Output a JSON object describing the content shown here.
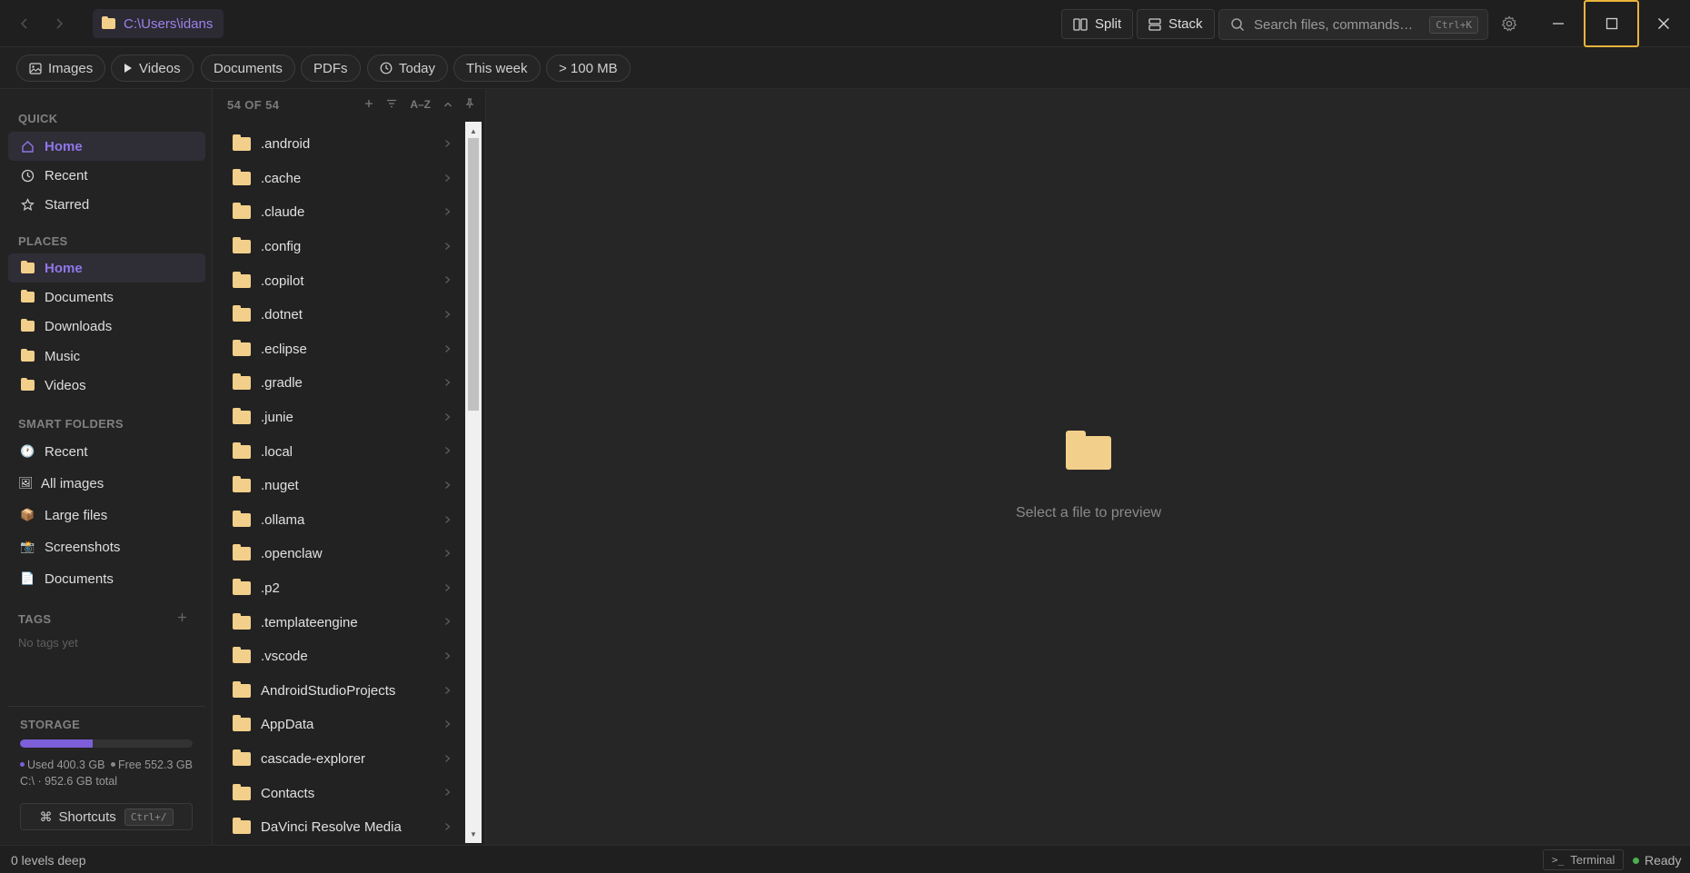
{
  "titlebar": {
    "path": "C:\\Users\\idans",
    "split_label": "Split",
    "stack_label": "Stack",
    "search_placeholder": "Search files, commands…",
    "search_shortcut": "Ctrl+K"
  },
  "filters": [
    "Images",
    "Videos",
    "Documents",
    "PDFs",
    "Today",
    "This week",
    "> 100 MB"
  ],
  "sidebar": {
    "quick_label": "QUICK",
    "quick": [
      "Home",
      "Recent",
      "Starred"
    ],
    "places_label": "PLACES",
    "places": [
      "Home",
      "Documents",
      "Downloads",
      "Music",
      "Videos"
    ],
    "smart_label": "SMART FOLDERS",
    "smart": [
      {
        "icon": "🕐",
        "label": "Recent"
      },
      {
        "icon": "🖼",
        "label": "All images"
      },
      {
        "icon": "📦",
        "label": "Large files"
      },
      {
        "icon": "📸",
        "label": "Screenshots"
      },
      {
        "icon": "📄",
        "label": "Documents"
      }
    ],
    "tags_label": "TAGS",
    "tags_empty": "No tags yet",
    "storage_label": "STORAGE",
    "storage_used_fraction": 0.42,
    "storage_used": "Used 400.3 GB",
    "storage_free": "Free 552.3 GB",
    "storage_total": "C:\\ · 952.6 GB total",
    "shortcuts_label": "Shortcuts",
    "shortcuts_kbd": "Ctrl+/"
  },
  "filelist": {
    "count_label": "54 OF 54",
    "sort_label": "A–Z",
    "items": [
      ".android",
      ".cache",
      ".claude",
      ".config",
      ".copilot",
      ".dotnet",
      ".eclipse",
      ".gradle",
      ".junie",
      ".local",
      ".nuget",
      ".ollama",
      ".openclaw",
      ".p2",
      ".templateengine",
      ".vscode",
      "AndroidStudioProjects",
      "AppData",
      "cascade-explorer",
      "Contacts",
      "DaVinci Resolve Media"
    ]
  },
  "preview": {
    "empty_text": "Select a file to preview"
  },
  "status": {
    "depth": "0 levels deep",
    "terminal": "Terminal",
    "ready": "Ready"
  },
  "colors": {
    "accent": "#8f77ea",
    "folder": "#f2cf8a",
    "focus": "#e9b43c",
    "ok": "#4caf50"
  }
}
